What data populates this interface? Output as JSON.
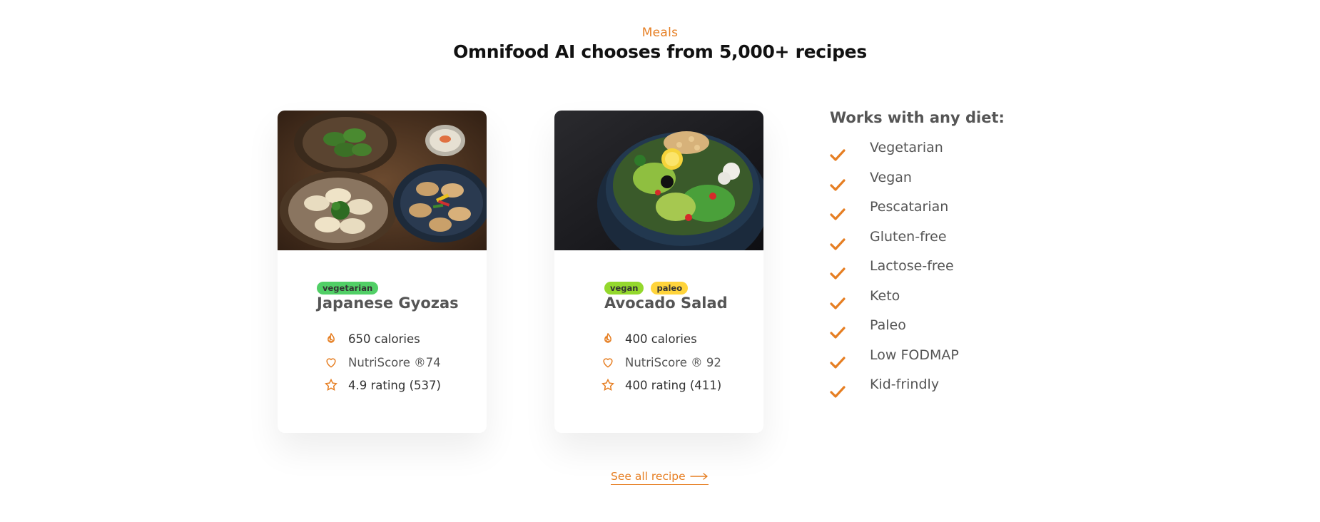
{
  "section": {
    "subheading": "Meals",
    "heading": "Omnifood AI chooses from 5,000+ recipes"
  },
  "meals": [
    {
      "tags": [
        "vegetarian"
      ],
      "title": "Japanese Gyozas",
      "calories": "650 calories",
      "nutriscore": "NutriScore ®74",
      "rating": "4.9 rating (537)",
      "icons": [
        "flame-icon",
        "heart-icon",
        "star-icon"
      ]
    },
    {
      "tags": [
        "vegan",
        "paleo"
      ],
      "title": "Avocado Salad",
      "calories": "400 calories",
      "nutriscore": "NutriScore ® 92",
      "rating": "400 rating (411)",
      "icons": [
        "flame-icon",
        "heart-icon",
        "star-icon"
      ]
    }
  ],
  "diets": {
    "title": "Works with any diet:",
    "items": [
      "Vegetarian",
      "Vegan",
      "Pescatarian",
      "Gluten-free",
      "Lactose-free",
      "Keto",
      "Paleo",
      "Low FODMAP",
      "Kid-frindly"
    ],
    "icon": "checkmark-icon"
  },
  "link": {
    "label": "See all recipe",
    "icon": "arrow-right-icon"
  },
  "colors": {
    "accent": "#e67e22",
    "vegetarian_tag": "#51cf66",
    "vegan_tag": "#94d82d",
    "paleo_tag": "#ffd43b"
  }
}
